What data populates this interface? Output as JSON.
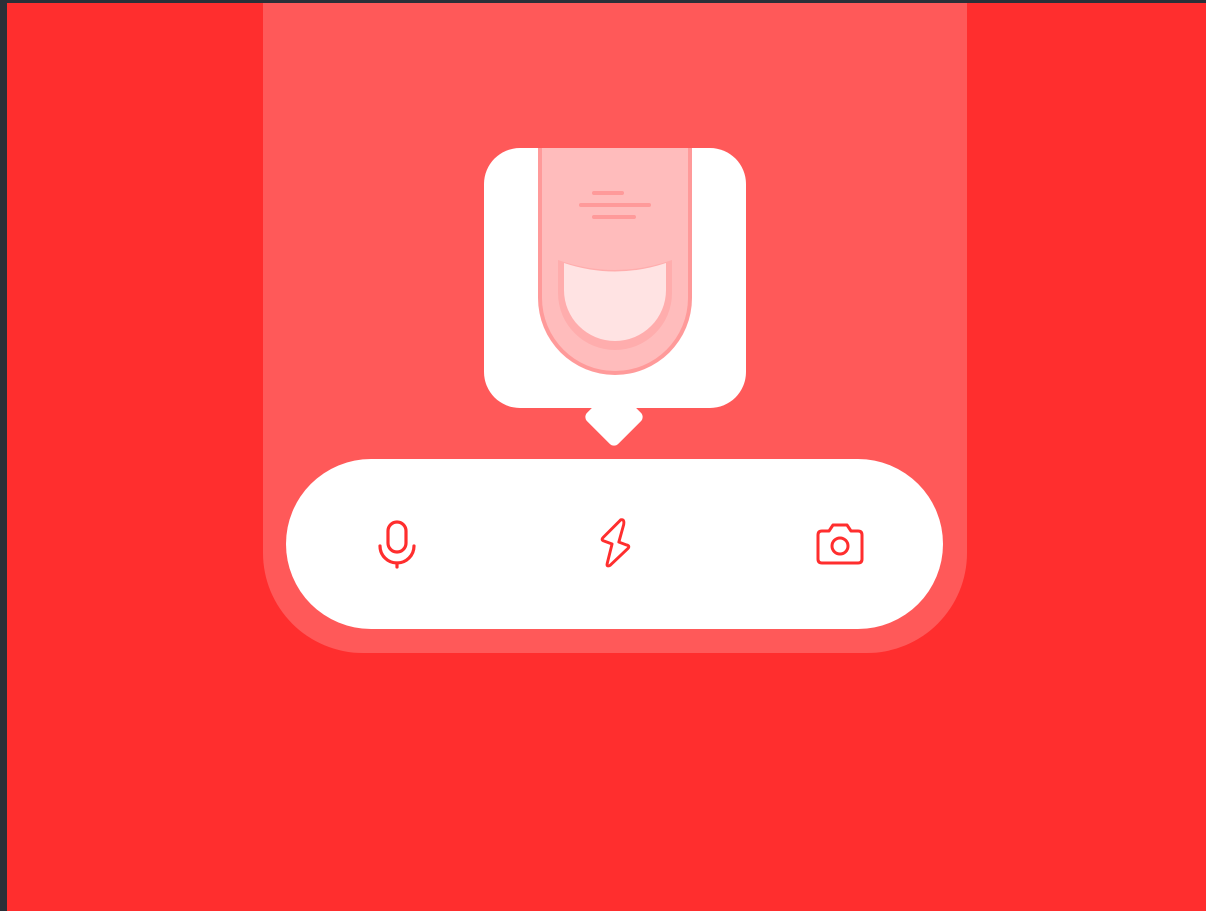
{
  "app": {
    "background_color": "#ff2e2e",
    "panel_color": "#ff5959",
    "accent_color": "#ff2e2e"
  },
  "popup": {
    "illustration": "pull-down-tab-icon"
  },
  "action_bar": {
    "buttons": [
      {
        "icon": "microphone-icon",
        "label": ""
      },
      {
        "icon": "lightning-icon",
        "label": ""
      },
      {
        "icon": "camera-icon",
        "label": ""
      }
    ]
  }
}
